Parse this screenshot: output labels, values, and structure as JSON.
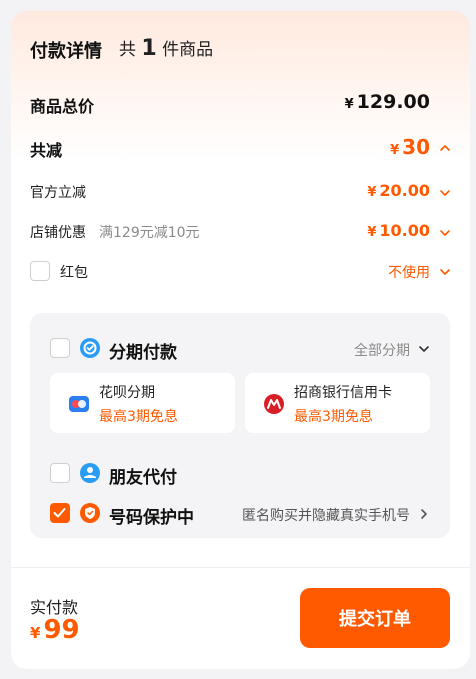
{
  "header": {
    "title": "付款详情",
    "count_prefix": "共",
    "count": "1",
    "count_suffix": "件商品"
  },
  "total": {
    "label": "商品总价",
    "currency": "¥",
    "value": "129.00"
  },
  "discount": {
    "label": "共减",
    "currency": "¥",
    "value": "30"
  },
  "official": {
    "label": "官方立减",
    "currency": "¥",
    "value": "20.00"
  },
  "store": {
    "label": "店铺优惠",
    "note": "满129元减10元",
    "currency": "¥",
    "value": "10.00"
  },
  "redpacket": {
    "label": "红包",
    "value": "不使用",
    "checked": false
  },
  "installment": {
    "label": "分期付款",
    "option": "全部分期",
    "checked": false,
    "plans": [
      {
        "name": "花呗分期",
        "promo": "最高3期免息"
      },
      {
        "name": "招商银行信用卡",
        "promo": "最高3期免息"
      }
    ]
  },
  "friend_pay": {
    "label": "朋友代付",
    "checked": false
  },
  "number_protect": {
    "label": "号码保护中",
    "desc": "匿名购买并隐藏真实手机号",
    "checked": true
  },
  "footer": {
    "pay_label": "实付款",
    "currency": "¥",
    "pay_amount": "99",
    "submit_label": "提交订单"
  },
  "colors": {
    "accent": "#ff5a00",
    "blue": "#2b9cf3",
    "panel": "#f4f4f6"
  }
}
